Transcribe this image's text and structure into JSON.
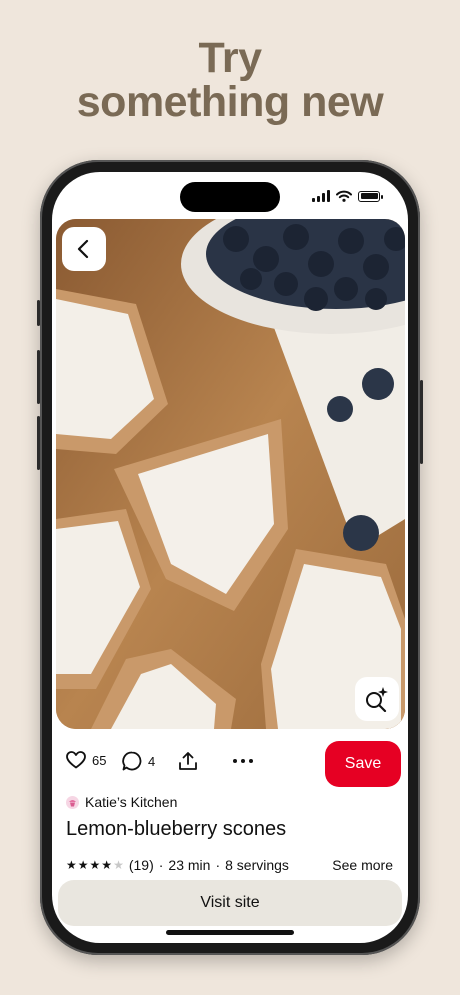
{
  "headline": {
    "line1": "Try",
    "line2": "something new"
  },
  "pin": {
    "likes": "65",
    "comments": "4",
    "save_label": "Save",
    "author": "Katie’s Kitchen",
    "title": "Lemon-blueberry scones",
    "rating_stars": 4,
    "rating_max": 5,
    "rating_count": "(19)",
    "time": "23 min",
    "servings": "8 servings",
    "sep": "·",
    "see_more": "See more",
    "visit_label": "Visit site"
  },
  "icons": {
    "back": "chevron-left-icon",
    "lens": "visual-search-icon",
    "like": "heart-icon",
    "comment": "comment-icon",
    "share": "share-icon",
    "more": "more-icon"
  },
  "colors": {
    "accent": "#e60023",
    "background": "#efe6dc",
    "headline": "#7a6a55"
  }
}
